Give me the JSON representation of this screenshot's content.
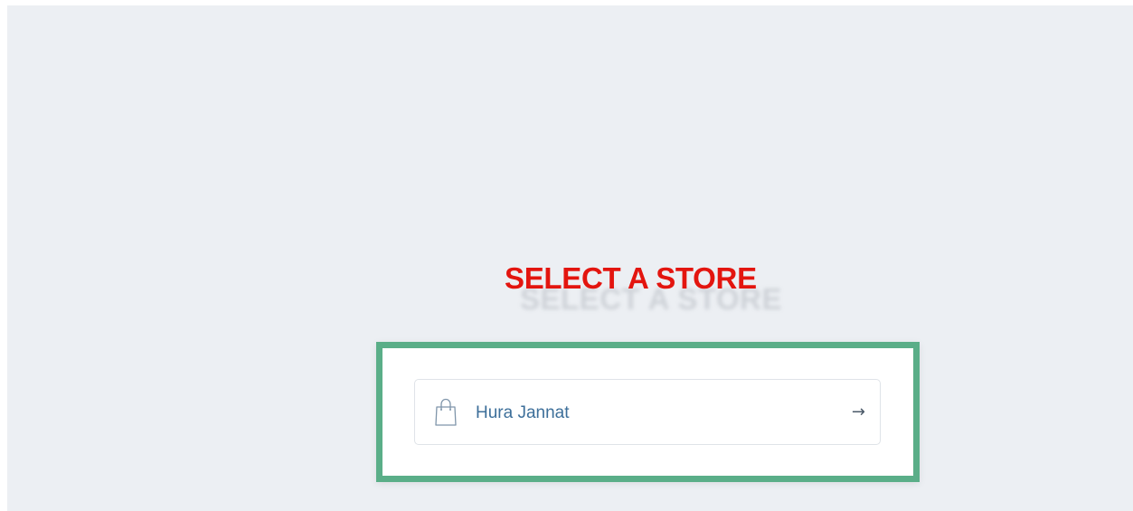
{
  "page": {
    "heading": "SELECT A STORE"
  },
  "store_list": {
    "items": [
      {
        "name": "Hura Jannat",
        "icon": "shopping-bag-icon",
        "action_icon": "arrow-right-icon"
      }
    ]
  },
  "colors": {
    "background": "#eceff3",
    "heading": "#e3150f",
    "card_border": "#5aae88",
    "store_name": "#3d6f9a"
  }
}
